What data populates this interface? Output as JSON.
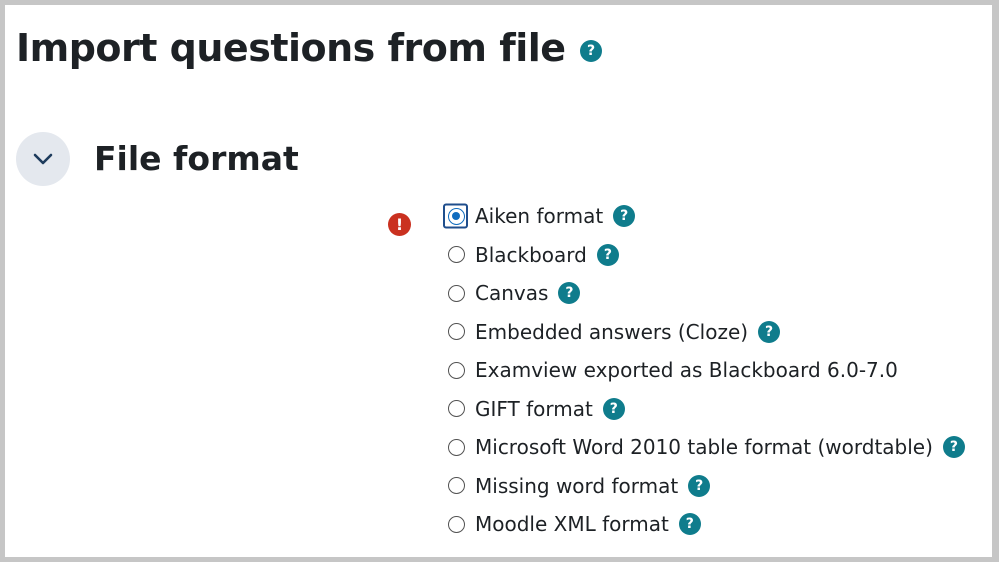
{
  "page": {
    "title": "Import questions from file",
    "title_help_icon": "question-circle",
    "title_help_glyph": "?"
  },
  "section": {
    "title": "File format",
    "expanded": true,
    "toggle_icon": "chevron-down"
  },
  "required_icon": {
    "name": "exclamation-circle",
    "glyph": "!",
    "color": "#ca3120"
  },
  "colors": {
    "help_icon": "#0f7c8c",
    "radio_selected": "#0f6cbf",
    "toggle_background": "#e4e8ee"
  },
  "file_formats": [
    {
      "label": "Aiken format",
      "checked": true,
      "has_help": true
    },
    {
      "label": "Blackboard",
      "checked": false,
      "has_help": true
    },
    {
      "label": "Canvas",
      "checked": false,
      "has_help": true
    },
    {
      "label": "Embedded answers (Cloze)",
      "checked": false,
      "has_help": true
    },
    {
      "label": "Examview exported as Blackboard 6.0-7.0",
      "checked": false,
      "has_help": false
    },
    {
      "label": "GIFT format",
      "checked": false,
      "has_help": true
    },
    {
      "label": "Microsoft Word 2010 table format (wordtable)",
      "checked": false,
      "has_help": true
    },
    {
      "label": "Missing word format",
      "checked": false,
      "has_help": true
    },
    {
      "label": "Moodle XML format",
      "checked": false,
      "has_help": true
    }
  ]
}
